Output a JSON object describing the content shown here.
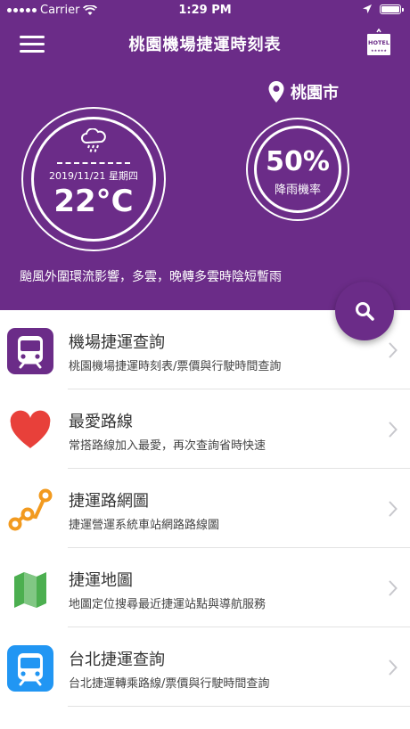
{
  "status_bar": {
    "carrier": "Carrier",
    "time": "1:29 PM"
  },
  "header": {
    "title": "桃園機場捷運時刻表",
    "hotel_label": "HOTEL"
  },
  "weather": {
    "date": "2019/11/21 星期四",
    "temperature": "22°C",
    "location": "桃園市",
    "rain_probability": "50%",
    "rain_label": "降雨機率",
    "forecast": "颱風外圍環流影響，多雲，晚轉多雲時陰短暫雨"
  },
  "menu": {
    "items": [
      {
        "title": "機場捷運查詢",
        "desc": "桃園機場捷運時刻表/票價與行駛時間查詢",
        "icon": "airport-train-icon"
      },
      {
        "title": "最愛路線",
        "desc": "常搭路線加入最愛，再次查詢省時快速",
        "icon": "heart-icon"
      },
      {
        "title": "捷運路網圖",
        "desc": "捷運營運系統車站網路路線圖",
        "icon": "route-map-icon"
      },
      {
        "title": "捷運地圖",
        "desc": "地圖定位搜尋最近捷運站點與導航服務",
        "icon": "map-icon"
      },
      {
        "title": "台北捷運查詢",
        "desc": "台北捷運轉乘路線/票價與行駛時間查詢",
        "icon": "taipei-train-icon"
      }
    ]
  },
  "colors": {
    "primary": "#6b2c88",
    "heart": "#e8403a",
    "route": "#f29a1f",
    "map": "#4caf50",
    "taipei": "#2196f3"
  }
}
